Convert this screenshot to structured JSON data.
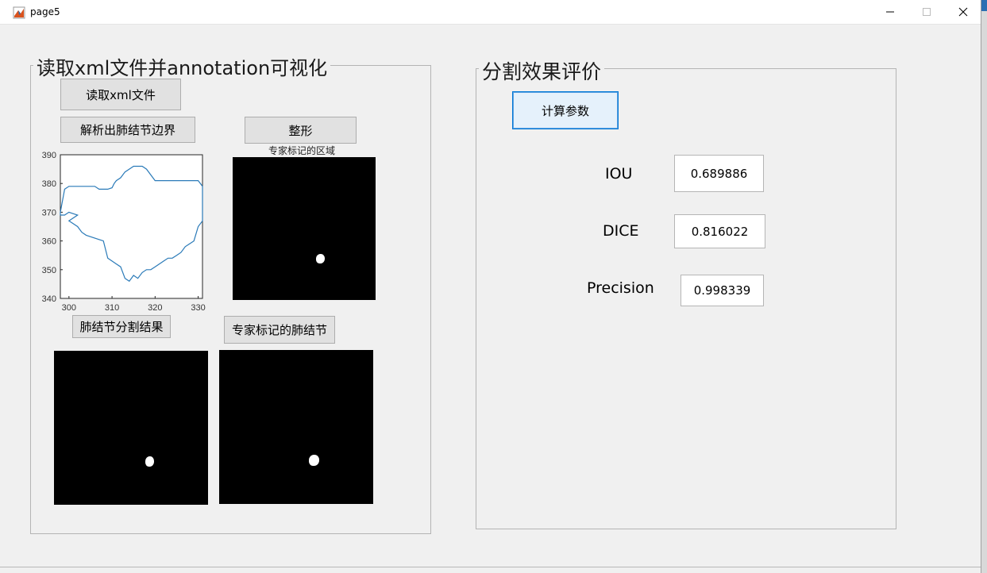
{
  "window": {
    "title": "page5",
    "minimize_icon": "minimize-icon",
    "maximize_icon": "maximize-icon",
    "close_icon": "close-icon",
    "app_icon": "matlab-icon"
  },
  "left_panel": {
    "title": "读取xml文件并annotation可视化",
    "read_button": "读取xml文件",
    "parse_button": "解析出肺结节边界",
    "reshape_button": "整形",
    "expert_region_title": "专家标记的区域",
    "segment_result_button": "肺结节分割结果",
    "expert_nodule_button": "专家标记的肺结节"
  },
  "right_panel": {
    "title": "分割效果评价",
    "compute_button": "计算参数",
    "iou_label": "IOU",
    "iou_value": "0.689886",
    "dice_label": "DICE",
    "dice_value": "0.816022",
    "precision_label": "Precision",
    "precision_value": "0.998339"
  },
  "chart_data": {
    "type": "line",
    "title": "",
    "xlabel": "",
    "ylabel": "",
    "xlim": [
      298,
      331
    ],
    "ylim": [
      340,
      390
    ],
    "x_ticks": [
      300,
      310,
      320,
      330
    ],
    "y_ticks": [
      340,
      350,
      360,
      370,
      380,
      390
    ],
    "grid": false,
    "color": "#2a7ab8",
    "series": [
      {
        "x": [
          298,
          299,
          300,
          306,
          307,
          309,
          310,
          310.5,
          311,
          312,
          313,
          314,
          315,
          316,
          317,
          318,
          320,
          325,
          330,
          331,
          331,
          330,
          329,
          328,
          327,
          326,
          325,
          324,
          323,
          322,
          320,
          319,
          318,
          317,
          316,
          315,
          314,
          313,
          312,
          311,
          309,
          308,
          304,
          303,
          302,
          301,
          300,
          301,
          302,
          300,
          299,
          298,
          298
        ],
        "y": [
          370,
          378,
          379,
          379,
          378,
          378,
          378.5,
          380,
          381,
          382,
          384,
          385,
          386,
          386,
          386,
          385,
          381,
          381,
          381,
          379,
          367,
          365,
          360,
          359,
          358,
          356,
          355,
          354,
          354,
          353,
          351,
          350,
          350,
          349,
          347,
          348,
          346,
          347,
          351,
          352,
          354,
          360,
          362,
          363,
          365,
          366,
          367,
          368,
          369,
          370,
          369,
          369,
          370
        ]
      }
    ]
  }
}
